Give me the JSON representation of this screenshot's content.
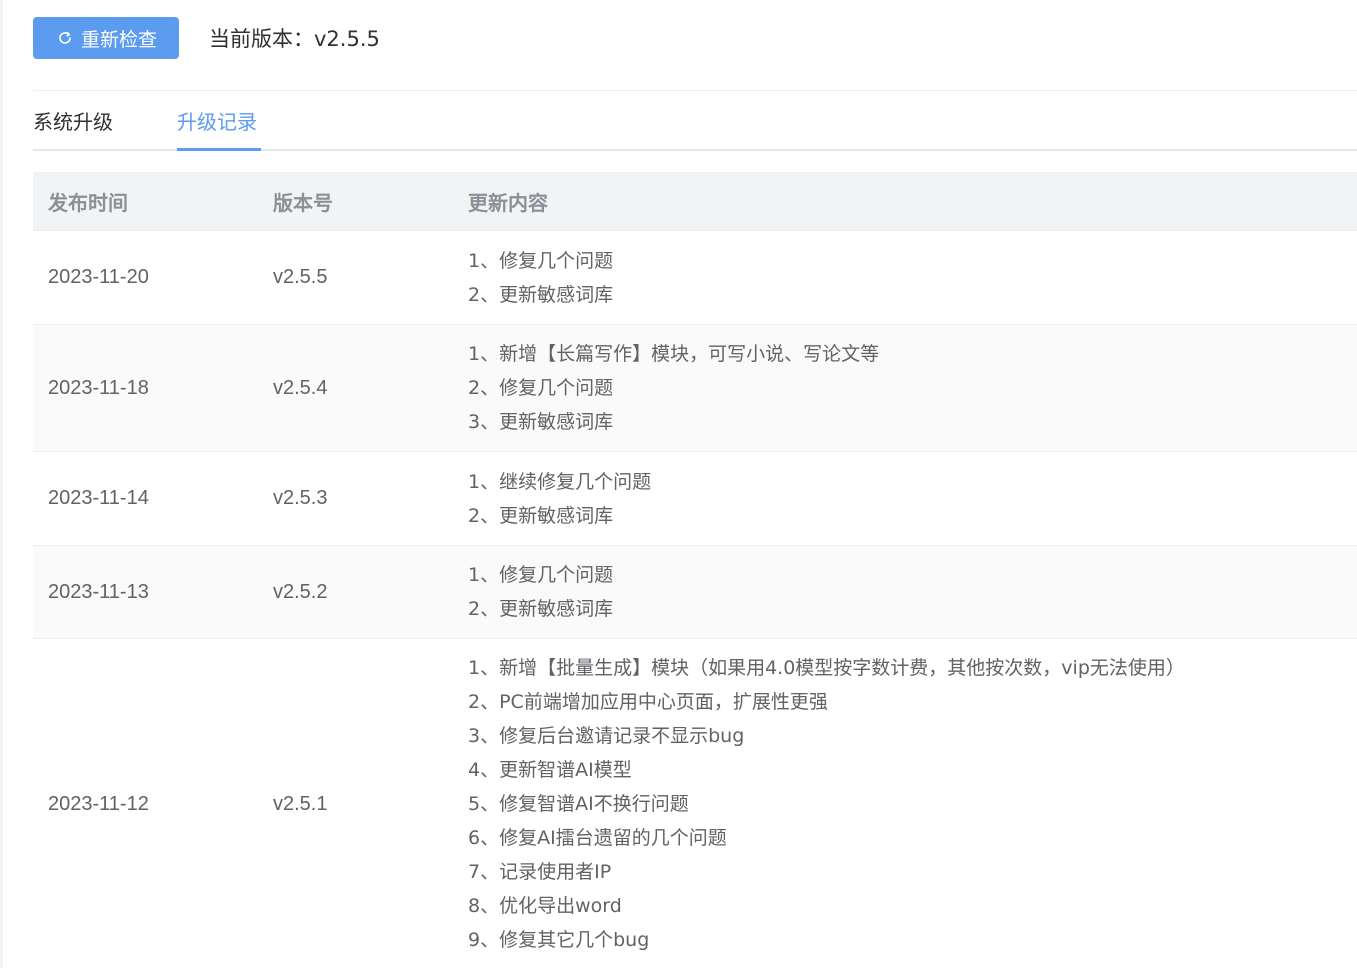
{
  "toolbar": {
    "recheck_label": "重新检查",
    "current_version": "当前版本：v2.5.5"
  },
  "tabs": [
    {
      "label": "系统升级",
      "active": false
    },
    {
      "label": "升级记录",
      "active": true
    }
  ],
  "table": {
    "headers": [
      "发布时间",
      "版本号",
      "更新内容"
    ],
    "rows": [
      {
        "date": "2023-11-20",
        "version": "v2.5.5",
        "items": [
          "1、修复几个问题",
          "2、更新敏感词库"
        ]
      },
      {
        "date": "2023-11-18",
        "version": "v2.5.4",
        "items": [
          "1、新增【长篇写作】模块，可写小说、写论文等",
          "2、修复几个问题",
          "3、更新敏感词库"
        ]
      },
      {
        "date": "2023-11-14",
        "version": "v2.5.3",
        "items": [
          "1、继续修复几个问题",
          "2、更新敏感词库"
        ]
      },
      {
        "date": "2023-11-13",
        "version": "v2.5.2",
        "items": [
          "1、修复几个问题",
          "2、更新敏感词库"
        ]
      },
      {
        "date": "2023-11-12",
        "version": "v2.5.1",
        "items": [
          "1、新增【批量生成】模块（如果用4.0模型按字数计费，其他按次数，vip无法使用）",
          "2、PC前端增加应用中心页面，扩展性更强",
          "3、修复后台邀请记录不显示bug",
          "4、更新智谱AI模型",
          "5、修复智谱AI不换行问题",
          "6、修复AI擂台遗留的几个问题",
          "7、记录使用者IP",
          "8、优化导出word",
          "9、修复其它几个bug"
        ]
      }
    ]
  },
  "colors": {
    "accent": "#5b9bf0",
    "header_bg": "#f2f3f5",
    "stripe_bg": "#fafafa"
  },
  "icons": {
    "recheck": "refresh-icon"
  }
}
